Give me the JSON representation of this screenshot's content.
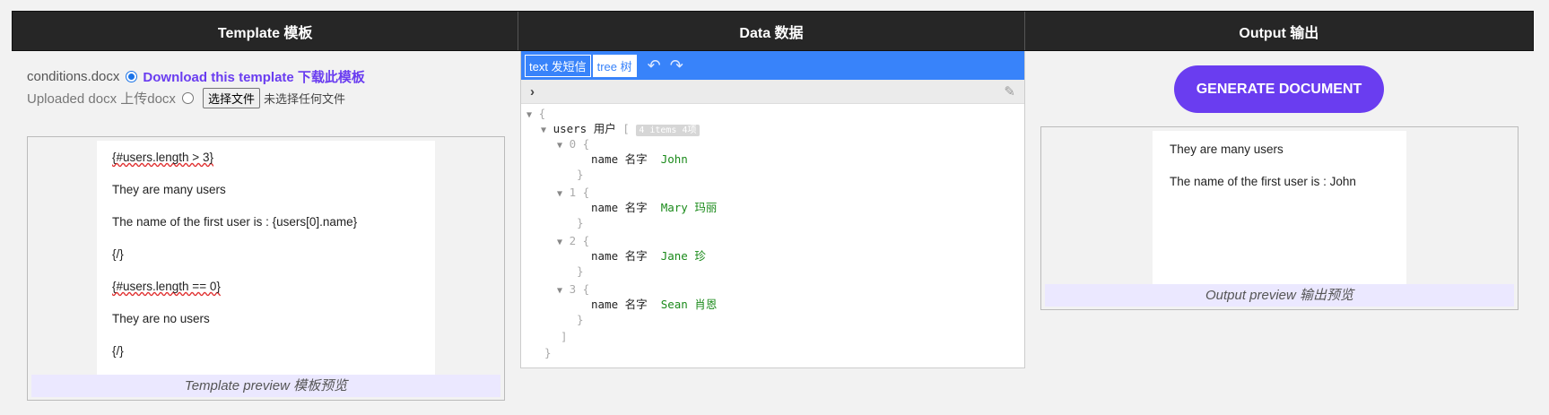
{
  "header": {
    "template_title": "Template 模板",
    "data_title": "Data 数据",
    "output_title": "Output 输出"
  },
  "template_source": {
    "filename": "conditions.docx",
    "download_link": "Download this template 下载此模板",
    "uploaded_label": "Uploaded docx 上传docx",
    "choose_file_button": "选择文件",
    "no_file_text": "未选择任何文件",
    "selected": "conditions.docx"
  },
  "template_preview": {
    "lines": [
      "{#users.length > 3}",
      "They are many users",
      "The name of the first user is : {users[0].name}",
      "{/}",
      "{#users.length == 0}",
      "They are no users",
      "{/}"
    ],
    "caption": "Template preview 模板预览"
  },
  "data_editor": {
    "mode_text": "text 发短信",
    "mode_tree": "tree 树",
    "undo_icon": "undo-icon",
    "redo_icon": "redo-icon",
    "root_open": "{",
    "root_close": "}",
    "users_key": "users 用户",
    "array_open": "[",
    "array_close": "]",
    "items_badge": "4 items 4项",
    "items": [
      {
        "index": "0",
        "key": "name 名字",
        "value": "John"
      },
      {
        "index": "1",
        "key": "name 名字",
        "value": "Mary 玛丽"
      },
      {
        "index": "2",
        "key": "name 名字",
        "value": "Jane 珍"
      },
      {
        "index": "3",
        "key": "name 名字",
        "value": "Sean 肖恩"
      }
    ]
  },
  "output": {
    "generate_button": "GENERATE DOCUMENT",
    "lines": [
      "They are many users",
      "The name of the first user is : John"
    ],
    "caption": "Output preview 输出预览"
  }
}
